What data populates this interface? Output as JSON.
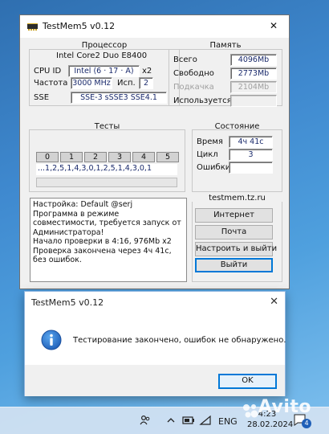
{
  "main_window": {
    "title": "TestMem5 v0.12",
    "close_glyph": "✕",
    "processor": {
      "title": "Процессор",
      "model": "Intel Core2 Duo  E8400",
      "cpu_id_label": "CPU ID",
      "cpu_id_value": "Intel (6 · 17 · A)",
      "cores_value": "x2",
      "freq_label": "Частота",
      "freq_value": "3000 MHz",
      "threads_label": "Исп.",
      "threads_value": "2",
      "sse_label": "SSE",
      "sse_value": "SSE-3 sSSE3 SSE4.1"
    },
    "memory": {
      "title": "Память",
      "total_label": "Всего",
      "total_value": "4096Mb",
      "free_label": "Свободно",
      "free_value": "2773Mb",
      "swap_label": "Подкачка",
      "swap_value": "2104Mb",
      "used_label": "Используется",
      "used_value": ""
    },
    "tests": {
      "title": "Тесты",
      "passes": [
        "0",
        "1",
        "2",
        "3",
        "4",
        "5"
      ],
      "sequence": "...1,2,5,1,4,3,0,1,2,5,1,4,3,0,1"
    },
    "status": {
      "title": "Состояние",
      "time_label": "Время",
      "time_value": "4ч 41с",
      "cycle_label": "Цикл",
      "cycle_value": "3",
      "errors_label": "Ошибки",
      "errors_value": ""
    },
    "log_text": "Настройка: Default @serj\nПрограмма в режиме совместимости, требуется запуск от Администратора!\nНачало проверки в 4:16, 976Mb x2\nПроверка закончена через 4ч 41с, без ошибок.",
    "site": "testmem.tz.ru",
    "buttons": {
      "internet": "Интернет",
      "mail": "Почта",
      "configure_exit": "Настроить и выйти",
      "exit": "Выйти"
    }
  },
  "dialog": {
    "title": "TestMem5 v0.12",
    "close_glyph": "✕",
    "icon": "info-icon",
    "message": "Тестирование закончено, ошибок не обнаружено.",
    "ok_label": "OK"
  },
  "taskbar": {
    "language": "ENG",
    "time": "4:23",
    "date": "28.02.2024",
    "notifications_count": "4",
    "watermark": "Avito"
  },
  "colors": {
    "value_text": "#1a2a6c",
    "focus_blue": "#0078d7",
    "info_blue": "#1f6fc5"
  }
}
